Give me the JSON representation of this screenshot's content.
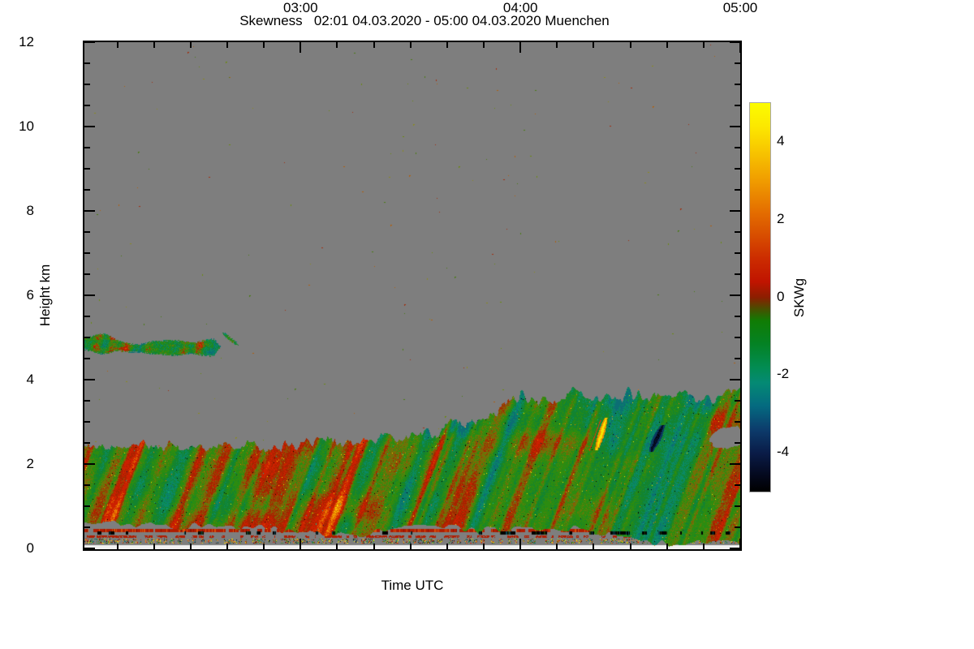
{
  "title": "Skewness   02:01 04.03.2020 - 05:00 04.03.2020 Muenchen",
  "chart_data": {
    "type": "heatmap",
    "title": "Skewness   02:01 04.03.2020 - 05:00 04.03.2020 Muenchen",
    "xlabel": "Time UTC",
    "ylabel": "Height km",
    "station": "Muenchen",
    "time_start": "02:01 04.03.2020",
    "time_end": "05:00 04.03.2020",
    "x_axis": {
      "start_min": 121,
      "end_min": 300,
      "major_ticks": [
        {
          "min": 180,
          "label": "03:00"
        },
        {
          "min": 240,
          "label": "04:00"
        },
        {
          "min": 300,
          "label": "05:00"
        }
      ],
      "minor_step_min": 10
    },
    "y_axis": {
      "min_km": 0,
      "max_km": 12,
      "major_ticks": [
        {
          "km": 0,
          "label": "0"
        },
        {
          "km": 2,
          "label": "2"
        },
        {
          "km": 4,
          "label": "4"
        },
        {
          "km": 6,
          "label": "6"
        },
        {
          "km": 8,
          "label": "8"
        },
        {
          "km": 10,
          "label": "10"
        },
        {
          "km": 12,
          "label": "12"
        }
      ],
      "minor_step_km": 0.5
    },
    "colorbar": {
      "label": "SKWg",
      "min": -5,
      "max": 5,
      "major_ticks": [
        {
          "v": 4,
          "label": "4"
        },
        {
          "v": 2,
          "label": "2"
        },
        {
          "v": 0,
          "label": "0"
        },
        {
          "v": -2,
          "label": "-2"
        },
        {
          "v": -4,
          "label": "-4"
        }
      ],
      "minor_tick_values": [
        3,
        1,
        -1,
        -3
      ],
      "gradient_stops": [
        [
          0,
          "#fcfc00"
        ],
        [
          6,
          "#fce800"
        ],
        [
          12,
          "#f8c800"
        ],
        [
          20,
          "#f09c00"
        ],
        [
          28,
          "#e46e00"
        ],
        [
          34,
          "#d84e00"
        ],
        [
          40,
          "#cc2c00"
        ],
        [
          46,
          "#c01400"
        ],
        [
          50,
          "#8c1e00"
        ],
        [
          53,
          "#484f00"
        ],
        [
          56,
          "#107c04"
        ],
        [
          62,
          "#048224"
        ],
        [
          68,
          "#028c52"
        ],
        [
          72,
          "#048a74"
        ],
        [
          78,
          "#046a80"
        ],
        [
          84,
          "#0c3c6c"
        ],
        [
          90,
          "#0a1c48"
        ],
        [
          96,
          "#04081c"
        ],
        [
          100,
          "#000000"
        ]
      ]
    },
    "no_data_color": "#7e7e7e",
    "bottom_blank_color": "#f2f2f2",
    "field_palette": [
      [
        0.93,
        "#f8e400"
      ],
      [
        0.78,
        "#f09c00"
      ],
      [
        0.6,
        "#e05a00"
      ],
      [
        0.34,
        "#cc2000"
      ],
      [
        0.16,
        "#a42400"
      ],
      [
        0.04,
        "#8c5a06"
      ],
      [
        -0.1,
        "#647c08"
      ],
      [
        -0.34,
        "#2c8c10"
      ],
      [
        -0.58,
        "#128430"
      ],
      [
        -0.78,
        "#0a8a64"
      ],
      [
        -9,
        "#0c6e74"
      ]
    ],
    "spice_colors": [
      [
        0.22,
        "#000000"
      ],
      [
        0.4,
        "#f8e400"
      ],
      [
        0.64,
        "#f07800"
      ],
      [
        0.78,
        "#0a1c48"
      ],
      [
        1.01,
        "#14b48c"
      ]
    ],
    "speckle": {
      "count": 210,
      "colors": [
        "#b06010",
        "#4a7a14",
        "#8a8a20",
        "#a03010",
        "#6a8a10"
      ]
    },
    "boundary_layer": {
      "top_profile_km": [
        [
          121,
          2.42
        ],
        [
          135,
          2.46
        ],
        [
          150,
          2.38
        ],
        [
          163,
          2.45
        ],
        [
          172,
          2.4
        ],
        [
          180,
          2.52
        ],
        [
          191,
          2.56
        ],
        [
          201,
          2.6
        ],
        [
          211,
          2.68
        ],
        [
          218,
          2.8
        ],
        [
          222,
          3.05
        ],
        [
          226,
          2.92
        ],
        [
          231,
          3.15
        ],
        [
          236,
          3.35
        ],
        [
          240,
          3.62
        ],
        [
          247,
          3.5
        ],
        [
          254,
          3.68
        ],
        [
          261,
          3.47
        ],
        [
          270,
          3.7
        ],
        [
          277,
          3.56
        ],
        [
          284,
          3.7
        ],
        [
          291,
          3.52
        ],
        [
          300,
          3.7
        ]
      ],
      "bottom_profile_km": [
        [
          121,
          0.58
        ],
        [
          160,
          0.52
        ],
        [
          176,
          0.45
        ],
        [
          186,
          0.3
        ],
        [
          196,
          0.33
        ],
        [
          205,
          0.5
        ],
        [
          214,
          0.55
        ],
        [
          228,
          0.45
        ],
        [
          240,
          0.52
        ],
        [
          252,
          0.48
        ],
        [
          262,
          0.4
        ],
        [
          270,
          0.28
        ],
        [
          276,
          0.14
        ],
        [
          300,
          0.1
        ]
      ]
    },
    "cloud_layer": {
      "t_start_min": 121,
      "t_end_min": 158,
      "center_km": 4.78,
      "max_half_thickness_km": 0.22,
      "fragment": {
        "t_start_min": 159,
        "t_end_min": 163,
        "top_km": 5.05,
        "bottom_km": 4.78
      }
    },
    "features": {
      "yellow_updraft": {
        "t_min": 261,
        "km_bottom": 2.35,
        "km_top": 3.1
      },
      "negative_skew_blob": {
        "t_min": 277,
        "km_bottom": 2.3,
        "km_top": 2.92
      },
      "gray_gap": {
        "t_min": 294,
        "km_center": 2.63
      }
    },
    "stripes": {
      "red_line_km": [
        0.4,
        0.47
      ],
      "black_dash_km": [
        0.34,
        0.4
      ],
      "red_dash_km": [
        0.26,
        0.31
      ],
      "speckle_row_km": [
        0.13,
        0.23
      ],
      "blank_km": [
        0.0,
        0.085
      ]
    },
    "seed": 1337
  }
}
